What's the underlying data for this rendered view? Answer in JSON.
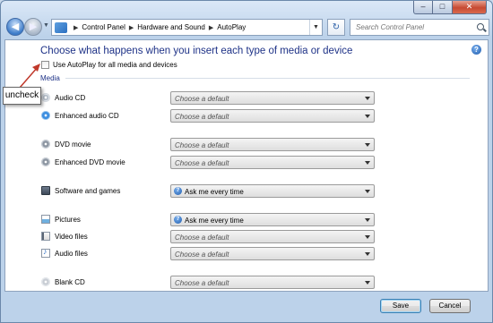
{
  "window": {
    "controls": {
      "minimize": "–",
      "maximize": "□",
      "close": "✕"
    }
  },
  "addressbar": {
    "breadcrumbs": [
      "Control Panel",
      "Hardware and Sound",
      "AutoPlay"
    ],
    "search_placeholder": "Search Control Panel"
  },
  "main": {
    "heading": "Choose what happens when you insert each type of media or device",
    "autoplay_checkbox": {
      "label": "Use AutoPlay for all media and devices",
      "checked": false
    },
    "section_title": "Media",
    "rows": [
      {
        "label": "Audio CD",
        "icon": "audio-cd-icon",
        "value": "Choose a default"
      },
      {
        "label": "Enhanced audio CD",
        "icon": "enhanced-audio-cd-icon",
        "value": "Choose a default"
      },
      {
        "label": "DVD movie",
        "icon": "dvd-movie-icon",
        "value": "Choose a default"
      },
      {
        "label": "Enhanced DVD movie",
        "icon": "enhanced-dvd-icon",
        "value": "Choose a default"
      },
      {
        "label": "Software and games",
        "icon": "software-games-icon",
        "value": "Ask me every time"
      },
      {
        "label": "Pictures",
        "icon": "pictures-icon",
        "value": "Ask me every time"
      },
      {
        "label": "Video files",
        "icon": "video-files-icon",
        "value": "Choose a default"
      },
      {
        "label": "Audio files",
        "icon": "audio-files-icon",
        "value": "Choose a default"
      },
      {
        "label": "Blank CD",
        "icon": "blank-cd-icon",
        "value": "Choose a default"
      }
    ]
  },
  "footer": {
    "save_label": "Save",
    "cancel_label": "Cancel"
  },
  "annotation": {
    "callout_text": "uncheck",
    "arrow_color": "#c0392b"
  }
}
